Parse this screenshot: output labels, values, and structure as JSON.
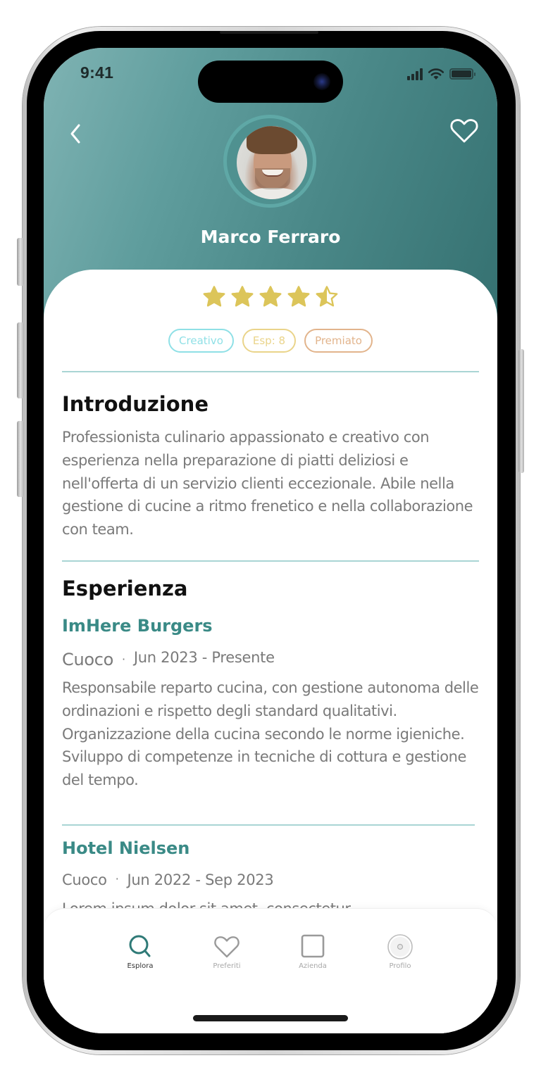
{
  "status_bar": {
    "time": "9:41",
    "icons": [
      "cellular-signal-icon",
      "wifi-icon",
      "battery-icon"
    ]
  },
  "header": {
    "back_icon": "chevron-left-icon",
    "favorite_icon": "heart-outline-icon",
    "profile_name": "Marco Ferraro",
    "avatar_alt": "Marco Ferraro profile photo"
  },
  "rating": {
    "value": 4.5,
    "max": 5
  },
  "tags": [
    {
      "label": "Creativo",
      "color": "#8fe0e6"
    },
    {
      "label": "Esp: 8",
      "color": "#ead48a"
    },
    {
      "label": "Premiato",
      "color": "#e2b48c"
    }
  ],
  "introduction": {
    "title": "Introduzione",
    "text": "Professionista culinario appassionato e creativo con esperienza nella preparazione di piatti deliziosi e nell'offerta di un servizio clienti eccezionale. Abile nella gestione di cucine a ritmo frenetico e nella collaborazione con team."
  },
  "experience": {
    "title": "Esperienza",
    "items": [
      {
        "company": "ImHere Burgers",
        "role": "Cuoco",
        "separator": "·",
        "dates": "Jun 2023 - Presente",
        "description": "Responsabile reparto cucina, con gestione autonoma delle ordinazioni e rispetto degli standard qualitativi. Organizzazione della cucina secondo le norme igieniche. Sviluppo di competenze in tecniche di cottura e gestione del tempo."
      },
      {
        "company": "Hotel Nielsen",
        "role": "Cuoco",
        "separator": "·",
        "dates": "Jun 2022 - Sep 2023",
        "description": "Lorem ipsum dolor sit amet, consectetur"
      }
    ]
  },
  "bottom_nav": {
    "items": [
      {
        "label": "Esplora",
        "icon": "search-icon",
        "active": true
      },
      {
        "label": "Preferiti",
        "icon": "heart-icon",
        "active": false
      },
      {
        "label": "Azienda",
        "icon": "square-icon",
        "active": false
      },
      {
        "label": "Profilo",
        "icon": "profile-icon",
        "active": false
      }
    ]
  },
  "colors": {
    "brand_teal": "#3a8a86",
    "header_gradient_start": "#7fb3b3",
    "header_gradient_end": "#357171",
    "star_gold": "#dcc55a",
    "divider": "#a9d5d4",
    "body_text": "#7a7a7a"
  }
}
